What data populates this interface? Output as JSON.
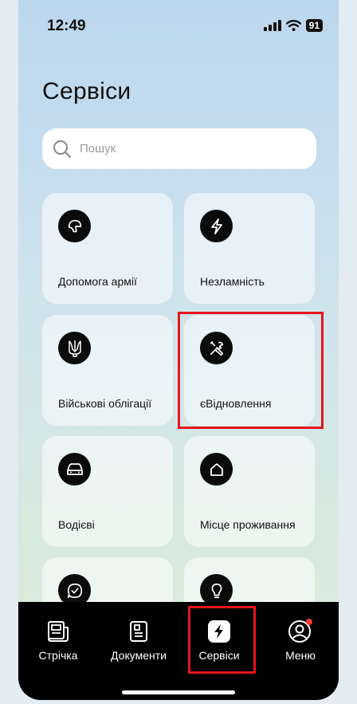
{
  "status_bar": {
    "time": "12:49",
    "battery": "91"
  },
  "page": {
    "title": "Сервіси"
  },
  "search": {
    "placeholder": "Пошук"
  },
  "services": [
    {
      "label": "Допомога армії",
      "icon": "helmet-icon"
    },
    {
      "label": "Незламність",
      "icon": "lightning-icon"
    },
    {
      "label": "Військові облігації",
      "icon": "trident-icon"
    },
    {
      "label": "єВідновлення",
      "icon": "tools-icon"
    },
    {
      "label": "Водієві",
      "icon": "car-icon"
    },
    {
      "label": "Місце проживання",
      "icon": "house-icon"
    },
    {
      "label": "",
      "icon": "chat-check-icon"
    },
    {
      "label": "",
      "icon": "lightbulb-icon"
    }
  ],
  "tabbar": {
    "items": [
      {
        "label": "Стрічка",
        "icon": "feed-icon"
      },
      {
        "label": "Документи",
        "icon": "documents-icon"
      },
      {
        "label": "Сервіси",
        "icon": "services-icon",
        "active": true
      },
      {
        "label": "Меню",
        "icon": "profile-icon",
        "badge_color": "#ff3b30"
      }
    ]
  },
  "colors": {
    "highlight": "#e8141b",
    "tabbar_bg": "#000000"
  }
}
